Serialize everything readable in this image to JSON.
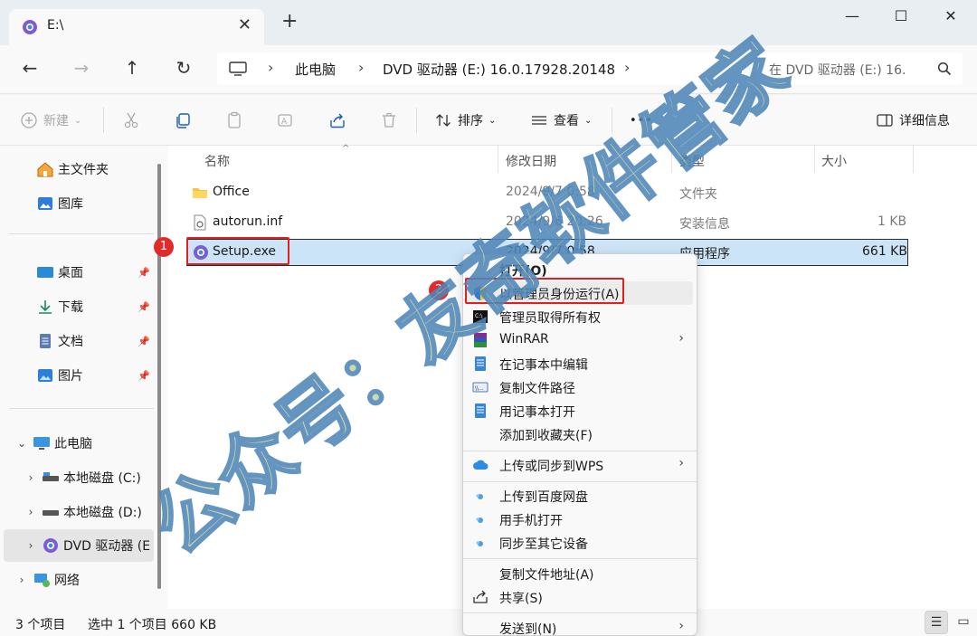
{
  "window": {
    "tab_title": "E:\\",
    "tab_close": "✕",
    "new_tab": "+",
    "minimize": "—",
    "maximize": "☐",
    "close": "✕"
  },
  "nav": {
    "back": "←",
    "forward": "→",
    "up": "↑",
    "refresh": "↻",
    "breadcrumb": [
      "此电脑",
      "DVD 驱动器 (E:) 16.0.17928.20148"
    ],
    "crumb_separator": "›",
    "search_placeholder": "在 DVD 驱动器 (E:) 16."
  },
  "toolbar": {
    "new_label": "新建",
    "sort_label": "排序",
    "view_label": "查看",
    "more_label": "•••",
    "details_label": "详细信息"
  },
  "sidebar": {
    "home": "主文件夹",
    "gallery": "图库",
    "desktop": "桌面",
    "downloads": "下载",
    "documents": "文档",
    "pictures": "图片",
    "this_pc": "此电脑",
    "drive_c": "本地磁盘 (C:)",
    "drive_d": "本地磁盘 (D:)",
    "drive_e": "DVD 驱动器 (E",
    "network": "网络"
  },
  "columns": {
    "name": "名称",
    "modified": "修改日期",
    "type": "类型",
    "size": "大小"
  },
  "files": [
    {
      "name": "Office",
      "modified": "2024/9/7 0:58",
      "type": "文件夹",
      "size": ""
    },
    {
      "name": "autorun.inf",
      "modified": "2024/9/6 20:26",
      "type": "安装信息",
      "size": "1 KB"
    },
    {
      "name": "Setup.exe",
      "modified": "2024/9/7 0:58",
      "type": "应用程序",
      "size": "661 KB"
    }
  ],
  "badges": {
    "one": "1",
    "two": "2"
  },
  "context_menu": {
    "open": "打开(O)",
    "run_as_admin": "以管理员身份运行(A)",
    "take_ownership": "管理员取得所有权",
    "winrar": "WinRAR",
    "edit_notepad": "在记事本中编辑",
    "copy_path": "复制文件路径",
    "open_notepad": "用记事本打开",
    "add_favorites": "添加到收藏夹(F)",
    "upload_wps": "上传或同步到WPS",
    "upload_baidu": "上传到百度网盘",
    "open_phone": "用手机打开",
    "sync_devices": "同步至其它设备",
    "copy_address": "复制文件地址(A)",
    "share": "共享(S)",
    "send_to": "发送到(N)",
    "submenu_arrow": "›"
  },
  "status": {
    "item_count": "3 个项目",
    "selection": "选中 1 个项目  660 KB"
  },
  "watermark": "公众号：友奇软件管家",
  "colors": {
    "selection_bg": "#cce4f7",
    "annotation_red": "#e02020",
    "watermark_fill": "#c9d6a0",
    "watermark_stroke": "#4f86b8"
  }
}
